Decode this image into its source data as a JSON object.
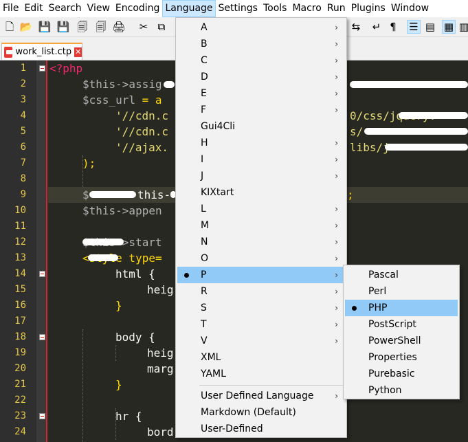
{
  "menubar": {
    "items": [
      "File",
      "Edit",
      "Search",
      "View",
      "Encoding",
      "Language",
      "Settings",
      "Tools",
      "Macro",
      "Run",
      "Plugins",
      "Window"
    ],
    "active": "Language"
  },
  "tab": {
    "filename": "work_list.ctp",
    "close_glyph": "✕"
  },
  "toolbar": {
    "icons": [
      {
        "name": "new-file-icon",
        "glyph": "🗋"
      },
      {
        "name": "open-file-icon",
        "glyph": "📂"
      },
      {
        "name": "save-icon",
        "glyph": "💾"
      },
      {
        "name": "save-all-icon",
        "glyph": "💾"
      },
      {
        "name": "close-icon",
        "glyph": "🗐"
      },
      {
        "name": "close-all-icon",
        "glyph": "🗐"
      },
      {
        "name": "print-icon",
        "glyph": "🖨"
      },
      {
        "name": "cut-icon",
        "glyph": "✂"
      },
      {
        "name": "copy-icon",
        "glyph": "⧉"
      }
    ],
    "right_icons": [
      {
        "name": "sync-icon",
        "glyph": "⇆"
      },
      {
        "name": "word-wrap-icon",
        "glyph": "↵"
      },
      {
        "name": "show-all-chars-icon",
        "glyph": "¶"
      },
      {
        "name": "indent-guide-icon",
        "glyph": "☰"
      },
      {
        "name": "doc-map-icon",
        "glyph": "▤"
      },
      {
        "name": "function-list-icon",
        "glyph": "▦"
      },
      {
        "name": "folder-workspace-icon",
        "glyph": "▥"
      }
    ]
  },
  "editor": {
    "line_numbers": [
      "1",
      "2",
      "3",
      "4",
      "5",
      "6",
      "7",
      "8",
      "9",
      "10",
      "11",
      "12",
      "13",
      "14",
      "15",
      "16",
      "17",
      "18",
      "19",
      "20",
      "21",
      "22",
      "23",
      "24"
    ],
    "fold_lines": [
      1,
      14,
      18,
      23
    ],
    "lines": {
      "l1": "<?php",
      "l2": "$this->assig",
      "l3a": "$css_url",
      "l3b": " = a",
      "l4": "'//cdn.c",
      "l4b": "0/css/jquery.",
      "l5": "'//cdn.c",
      "l5b": "s/",
      "l6": "'//ajax.",
      "l6b": "libs/j",
      "l7": ");",
      "l9a": "$",
      "l9b": "this-",
      "l9c": ";",
      "l10": "$this->appen",
      "l12": "$this->start",
      "l13": "<style type=",
      "l14": "html {",
      "l15": "heig",
      "l16": "}",
      "l18": "body {",
      "l19": "heig",
      "l20": "marg",
      "l21": "}",
      "l23": "hr {",
      "l24": "bord"
    }
  },
  "language_menu": {
    "items": [
      {
        "label": "A",
        "submenu": true
      },
      {
        "label": "B",
        "submenu": true
      },
      {
        "label": "C",
        "submenu": true
      },
      {
        "label": "D",
        "submenu": true
      },
      {
        "label": "E",
        "submenu": true
      },
      {
        "label": "F",
        "submenu": true
      },
      {
        "label": "Gui4Cli",
        "submenu": false
      },
      {
        "label": "H",
        "submenu": true
      },
      {
        "label": "I",
        "submenu": true
      },
      {
        "label": "J",
        "submenu": true
      },
      {
        "label": "KIXtart",
        "submenu": false
      },
      {
        "label": "L",
        "submenu": true
      },
      {
        "label": "M",
        "submenu": true
      },
      {
        "label": "N",
        "submenu": true
      },
      {
        "label": "O",
        "submenu": true
      },
      {
        "label": "P",
        "submenu": true,
        "checked": true,
        "hover": true
      },
      {
        "label": "R",
        "submenu": true
      },
      {
        "label": "S",
        "submenu": true
      },
      {
        "label": "T",
        "submenu": true
      },
      {
        "label": "V",
        "submenu": true
      },
      {
        "label": "XML",
        "submenu": false
      },
      {
        "label": "YAML",
        "submenu": false
      }
    ],
    "bottom_items": [
      {
        "label": "User Defined Language",
        "submenu": true
      },
      {
        "label": "Markdown (Default)",
        "submenu": false
      },
      {
        "label": "User-Defined",
        "submenu": false
      }
    ],
    "arrow_glyph": "›"
  },
  "p_submenu": {
    "items": [
      {
        "label": "Pascal"
      },
      {
        "label": "Perl"
      },
      {
        "label": "PHP",
        "checked": true
      },
      {
        "label": "PostScript"
      },
      {
        "label": "PowerShell"
      },
      {
        "label": "Properties"
      },
      {
        "label": "Purebasic"
      },
      {
        "label": "Python"
      }
    ]
  }
}
